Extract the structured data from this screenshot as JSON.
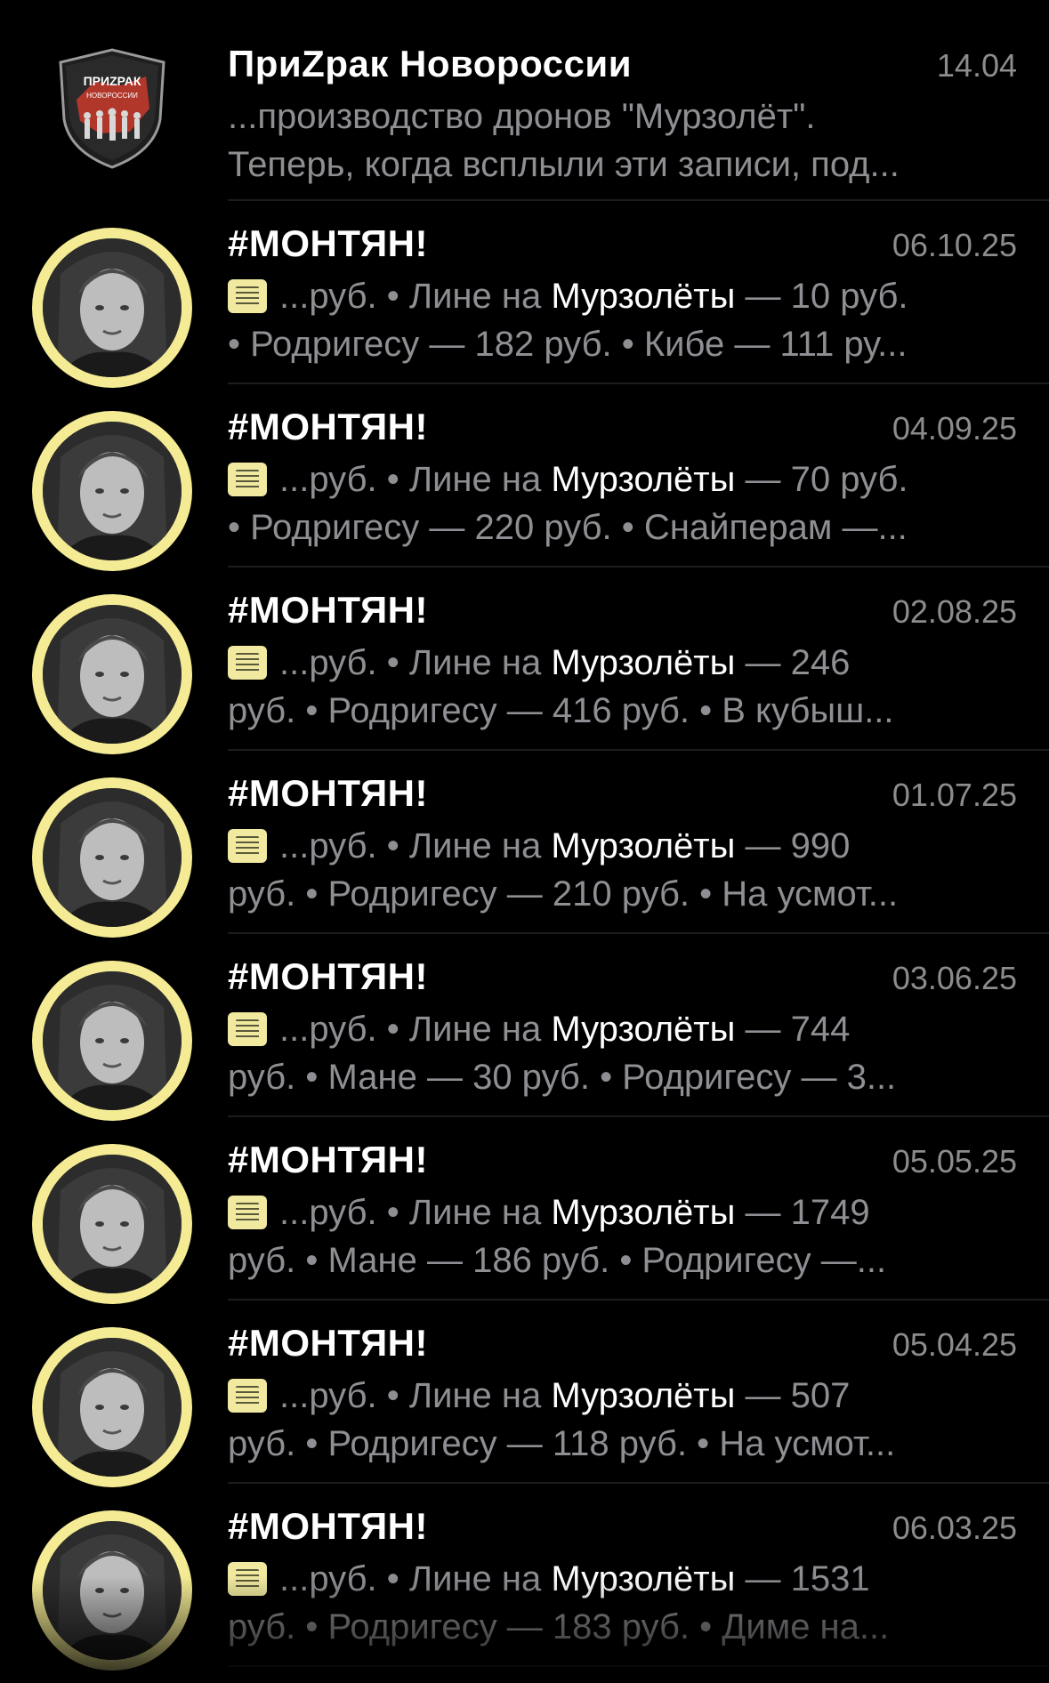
{
  "chats": [
    {
      "title": "ПриZрак Новороссии",
      "date": "14.04",
      "line1": "...производство дронов \"Мурзолёт\".",
      "line2": "Теперь, когда всплыли эти записи, под...",
      "avatar": {
        "type": "logo",
        "text_top": "ПРИZРАК",
        "text_bottom": "НОВОРОССИИ",
        "colors": [
          "#c0392b",
          "#2b2b2b"
        ]
      }
    },
    {
      "title": "#МОНТЯН!",
      "date": "06.10.25",
      "memo_icon": "memo-icon",
      "pre": "...руб. • Лине на ",
      "hl": "Мурзолёты",
      "post": " — 10 руб.",
      "line2": "• Родригесу — 182 руб. • Кибе — 111 ру..."
    },
    {
      "title": "#МОНТЯН!",
      "date": "04.09.25",
      "memo_icon": "memo-icon",
      "pre": "...руб. • Лине на ",
      "hl": "Мурзолёты",
      "post": " — 70 руб.",
      "line2": "• Родригесу — 220 руб. • Снайперам —..."
    },
    {
      "title": "#МОНТЯН!",
      "date": "02.08.25",
      "memo_icon": "memo-icon",
      "pre": "...руб. • Лине на ",
      "hl": "Мурзолёты",
      "post": " — 246",
      "line2": "руб. • Родригесу — 416 руб. • В кубыш..."
    },
    {
      "title": "#МОНТЯН!",
      "date": "01.07.25",
      "memo_icon": "memo-icon",
      "pre": "...руб. • Лине на ",
      "hl": "Мурзолёты",
      "post": " — 990",
      "line2": "руб. • Родригесу — 210 руб. • На усмот..."
    },
    {
      "title": "#МОНТЯН!",
      "date": "03.06.25",
      "memo_icon": "memo-icon",
      "pre": "...руб. • Лине на ",
      "hl": "Мурзолёты",
      "post": " — 744",
      "line2": "руб. • Мане — 30 руб. • Родригесу — 3..."
    },
    {
      "title": "#МОНТЯН!",
      "date": "05.05.25",
      "memo_icon": "memo-icon",
      "pre": "...руб. • Лине на ",
      "hl": "Мурзолёты",
      "post": " — 1749",
      "line2": "руб. • Мане — 186 руб. • Родригесу —..."
    },
    {
      "title": "#МОНТЯН!",
      "date": "05.04.25",
      "memo_icon": "memo-icon",
      "pre": "...руб. • Лине на ",
      "hl": "Мурзолёты",
      "post": " — 507",
      "line2": "руб. • Родригесу — 118 руб. • На усмот..."
    },
    {
      "title": "#МОНТЯН!",
      "date": "06.03.25",
      "memo_icon": "memo-icon",
      "pre": "...руб. • Лине на ",
      "hl": "Мурзолёты",
      "post": " — 1531",
      "line2": "руб. • Родригесу — 183 руб. • Диме на..."
    }
  ]
}
